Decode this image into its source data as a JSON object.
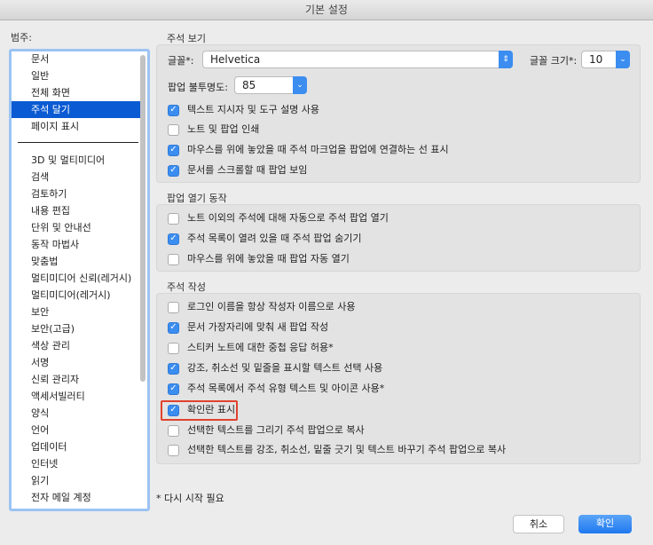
{
  "window": {
    "title": "기본 설정"
  },
  "sidebar": {
    "label": "범주:",
    "top_items": [
      "문서",
      "일반",
      "전체 화면",
      "주석 달기",
      "페이지 표시"
    ],
    "selected": "주석 달기",
    "items": [
      "3D 및 멀티미디어",
      "검색",
      "검토하기",
      "내용 편집",
      "단위 및 안내선",
      "동작 마법사",
      "맞춤법",
      "멀티미디어 신뢰(레거시)",
      "멀티미디어(레거시)",
      "보안",
      "보안(고급)",
      "색상 관리",
      "서명",
      "신뢰 관리자",
      "액세서빌러티",
      "양식",
      "언어",
      "업데이터",
      "인터넷",
      "읽기",
      "전자 메일 계정"
    ]
  },
  "view": {
    "title": "주석 보기",
    "font_label": "글꼴*:",
    "font_value": "Helvetica",
    "size_label": "글꼴 크기*:",
    "size_value": "10",
    "opacity_label": "팝업 불투명도:",
    "opacity_value": "85",
    "checks": [
      {
        "label": "텍스트 지시자 및 도구 설명 사용",
        "checked": true
      },
      {
        "label": "노트 및 팝업 인쇄",
        "checked": false
      },
      {
        "label": "마우스를 위에 놓았을 때 주석 마크업을 팝업에 연결하는 선 표시",
        "checked": true
      },
      {
        "label": "문서를 스크롤할 때 팝업 보임",
        "checked": true
      }
    ]
  },
  "popup": {
    "title": "팝업 열기 동작",
    "checks": [
      {
        "label": "노트 이외의 주석에 대해 자동으로 주석 팝업 열기",
        "checked": false
      },
      {
        "label": "주석 목록이 열려 있을 때 주석 팝업 숨기기",
        "checked": true
      },
      {
        "label": "마우스를 위에 놓았을 때 팝업 자동 열기",
        "checked": false
      }
    ]
  },
  "create": {
    "title": "주석 작성",
    "checks": [
      {
        "label": "로그인 이름을 항상 작성자 이름으로 사용",
        "checked": false
      },
      {
        "label": "문서 가장자리에 맞춰 새 팝업 작성",
        "checked": true
      },
      {
        "label": "스티커 노트에 대한 중첩 응답 허용*",
        "checked": false
      },
      {
        "label": "강조, 취소선 및 밑줄을 표시할 텍스트 선택 사용",
        "checked": true
      },
      {
        "label": "주석 목록에서 주석 유형 텍스트 및 아이콘 사용*",
        "checked": true
      },
      {
        "label": "확인란 표시",
        "checked": true
      },
      {
        "label": "선택한 텍스트를 그리기 주석 팝업으로 복사",
        "checked": false
      },
      {
        "label": "선택한 텍스트를 강조, 취소선, 밑줄 긋기 및 텍스트 바꾸기 주석 팝업으로 복사",
        "checked": false
      }
    ]
  },
  "footnote": "* 다시 시작 필요",
  "buttons": {
    "cancel": "취소",
    "ok": "확인"
  },
  "colors": {
    "accent": "#3b8df0",
    "selection": "#0a5ad3",
    "highlight": "#e0422e"
  }
}
